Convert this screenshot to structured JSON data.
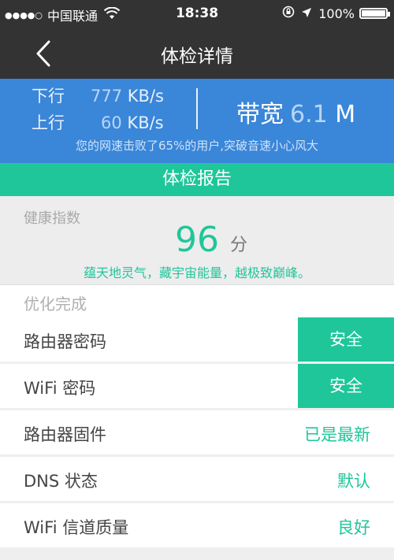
{
  "status_bar": {
    "signal_dots": "●●●●○",
    "carrier": "中国联通",
    "time": "18:38",
    "battery_percent": "100%"
  },
  "nav": {
    "title": "体检详情"
  },
  "speed": {
    "download_label": "下行",
    "download_value": "777",
    "download_unit": "KB/s",
    "upload_label": "上行",
    "upload_value": "60",
    "upload_unit": "KB/s",
    "bandwidth_label": "带宽",
    "bandwidth_value": "6.1",
    "bandwidth_unit": "M",
    "note": "您的网速击败了65%的用户,突破音速小心风大"
  },
  "report": {
    "title": "体检报告"
  },
  "health": {
    "label": "健康指数",
    "score": "96",
    "unit": "分",
    "slogan": "蕴天地灵气，藏宇宙能量，越极致巅峰。"
  },
  "optimized": {
    "label": "优化完成"
  },
  "items": [
    {
      "name": "路由器密码",
      "status": "安全",
      "style": "box"
    },
    {
      "name": "WiFi 密码",
      "status": "安全",
      "style": "box"
    },
    {
      "name": "路由器固件",
      "status": "已是最新",
      "style": "text"
    },
    {
      "name": "DNS 状态",
      "status": "默认",
      "style": "text"
    },
    {
      "name": "WiFi 信道质量",
      "status": "良好",
      "style": "text"
    }
  ],
  "colors": {
    "accent_green": "#1fc69a",
    "speed_blue": "#3a86d9",
    "header_dark": "#333333"
  }
}
